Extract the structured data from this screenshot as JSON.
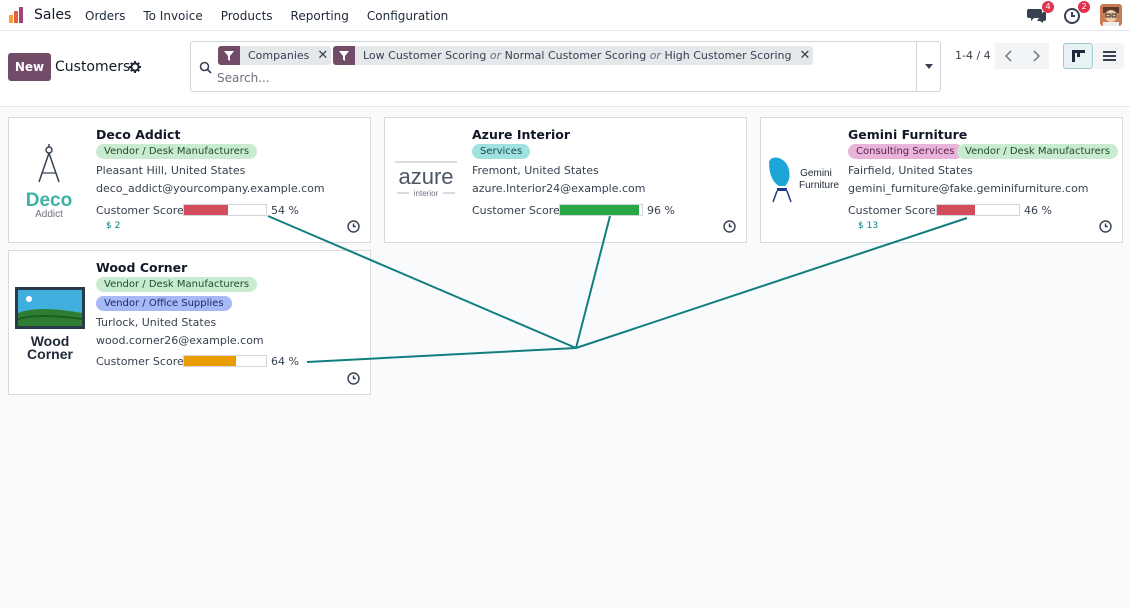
{
  "app": {
    "name": "Sales"
  },
  "menu": [
    "Orders",
    "To Invoice",
    "Products",
    "Reporting",
    "Configuration"
  ],
  "nav": {
    "messages_badge": "4",
    "activities_badge": "2"
  },
  "control": {
    "new_label": "New",
    "title": "Customers",
    "facets": {
      "companies": "Companies",
      "scoring_low": "Low Customer Scoring",
      "or1": "or",
      "scoring_normal": "Normal Customer Scoring",
      "or2": "or",
      "scoring_high": "High Customer Scoring"
    },
    "search_placeholder": "Search...",
    "pager": "1-4 / 4"
  },
  "cards": [
    {
      "name": "Deco Addict",
      "logo_text": "Deco",
      "logo_sub": "Addict",
      "tags": [
        "Vendor / Desk Manufacturers"
      ],
      "location": "Pleasant Hill, United States",
      "email": "deco_addict@yourcompany.example.com",
      "score_label": "Customer Score",
      "score": 54,
      "score_text": "54 %",
      "money": "$ 2"
    },
    {
      "name": "Azure Interior",
      "logo_text": "azure",
      "logo_sub": "interior",
      "tags": [
        "Services"
      ],
      "location": "Fremont, United States",
      "email": "azure.Interior24@example.com",
      "score_label": "Customer Score",
      "score": 96,
      "score_text": "96 %"
    },
    {
      "name": "Gemini Furniture",
      "logo_text": "Gemini",
      "logo_sub": "Furniture",
      "tags": [
        "Consulting Services",
        "Vendor / Desk Manufacturers"
      ],
      "location": "Fairfield, United States",
      "email": "gemini_furniture@fake.geminifurniture.com",
      "score_label": "Customer Score",
      "score": 46,
      "score_text": "46 %",
      "money": "$ 13"
    },
    {
      "name": "Wood Corner",
      "logo_text": "Wood",
      "logo_sub": "Corner",
      "tags": [
        "Vendor / Desk Manufacturers",
        "Vendor / Office Supplies"
      ],
      "location": "Turlock, United States",
      "email": "wood.corner26@example.com",
      "score_label": "Customer Score",
      "score": 64,
      "score_text": "64 %"
    }
  ],
  "colors": {
    "brand": "#714b67",
    "score_low": "#d44c59",
    "score_mid": "#e99d00",
    "score_high": "#28a745",
    "tag_green": "#c9ecd0",
    "tag_teal": "#9fe2e0",
    "tag_pink": "#e9b4d9",
    "tag_blue": "#a6b8f5",
    "annotation": "#137e80"
  }
}
